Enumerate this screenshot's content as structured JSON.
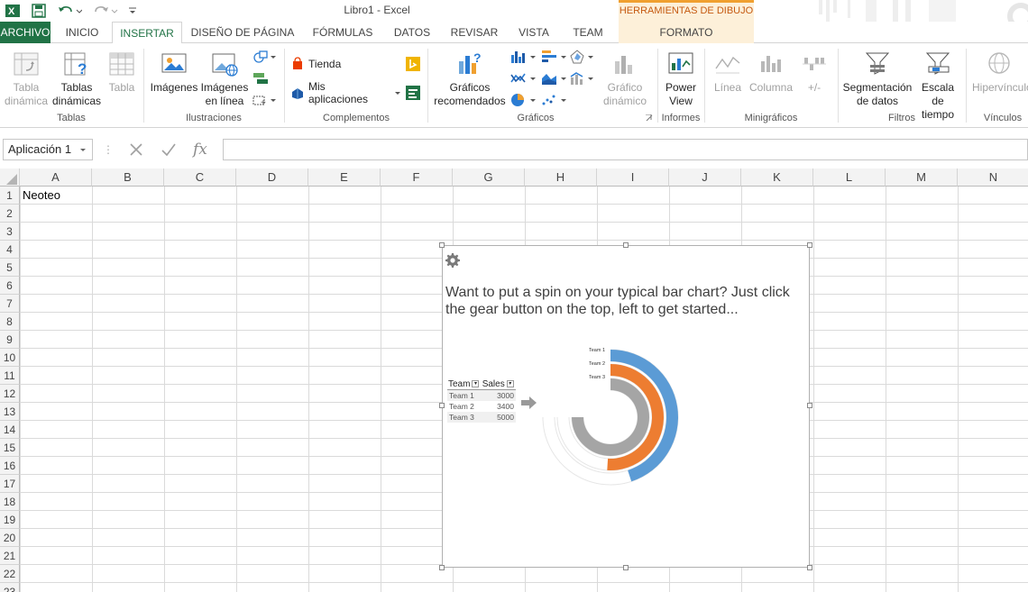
{
  "app": {
    "title": "Libro1 - Excel",
    "contextual_title": "HERRAMIENTAS DE DIBUJO"
  },
  "tabs": [
    "ARCHIVO",
    "INICIO",
    "INSERTAR",
    "DISEÑO DE PÁGINA",
    "FÓRMULAS",
    "DATOS",
    "REVISAR",
    "VISTA",
    "TEAM",
    "FORMATO"
  ],
  "ribbon": {
    "tabla_dinamica": [
      "Tabla",
      "dinámica"
    ],
    "tablas_dinamicas": [
      "Tablas",
      "dinámicas"
    ],
    "tabla": "Tabla",
    "imagenes": "Imágenes",
    "imagenes_linea": [
      "Imágenes",
      "en línea"
    ],
    "tienda": "Tienda",
    "mis_aplicaciones": "Mis aplicaciones",
    "graficos_recomendados": [
      "Gráficos",
      "recomendados"
    ],
    "grafico_dinamico": [
      "Gráfico",
      "dinámico"
    ],
    "power_view": [
      "Power",
      "View"
    ],
    "linea": "Línea",
    "columna": "Columna",
    "ganancia": "+/-",
    "segmentacion": [
      "Segmentación",
      "de datos"
    ],
    "escala": [
      "Escala de",
      "tiempo"
    ],
    "hipervinculo": "Hipervínculo",
    "groups": {
      "tablas": "Tablas",
      "ilustraciones": "Ilustraciones",
      "complementos": "Complementos",
      "graficos": "Gráficos",
      "informes": "Informes",
      "minigraficos": "Minigráficos",
      "filtros": "Filtros",
      "vinculos": "Vínculos"
    }
  },
  "formula_bar": {
    "name_box": "Aplicación 1",
    "formula_symbol": "fx",
    "value": ""
  },
  "sheet": {
    "columns": [
      "A",
      "B",
      "C",
      "D",
      "E",
      "F",
      "G",
      "H",
      "I",
      "J",
      "K",
      "L",
      "M",
      "N"
    ],
    "rows": [
      "1",
      "2",
      "3",
      "4",
      "5",
      "6",
      "7",
      "8",
      "9",
      "10",
      "11",
      "12",
      "13",
      "14",
      "15",
      "16",
      "17",
      "18",
      "19",
      "20",
      "21",
      "22",
      "23"
    ],
    "a1": "Neoteo"
  },
  "app_object": {
    "prompt": "Want to put a spin on your typical bar chart? Just click the gear button on the top, left to get started...",
    "table": {
      "headers": [
        "Team",
        "Sales"
      ],
      "rows": [
        [
          "Team 1",
          "3000"
        ],
        [
          "Team 2",
          "3400"
        ],
        [
          "Team 3",
          "5000"
        ]
      ]
    },
    "legend": [
      "Team 1",
      "Team 2",
      "Team 3"
    ]
  },
  "chart_data": {
    "type": "radial-bar",
    "categories": [
      "Team 1",
      "Team 2",
      "Team 3"
    ],
    "values": [
      3000,
      3400,
      5000
    ],
    "colors": [
      "#5b9bd5",
      "#ed7d31",
      "#a5a5a5"
    ]
  },
  "colors": {
    "excel_green": "#217346",
    "contextual_orange": "#f0a030"
  }
}
